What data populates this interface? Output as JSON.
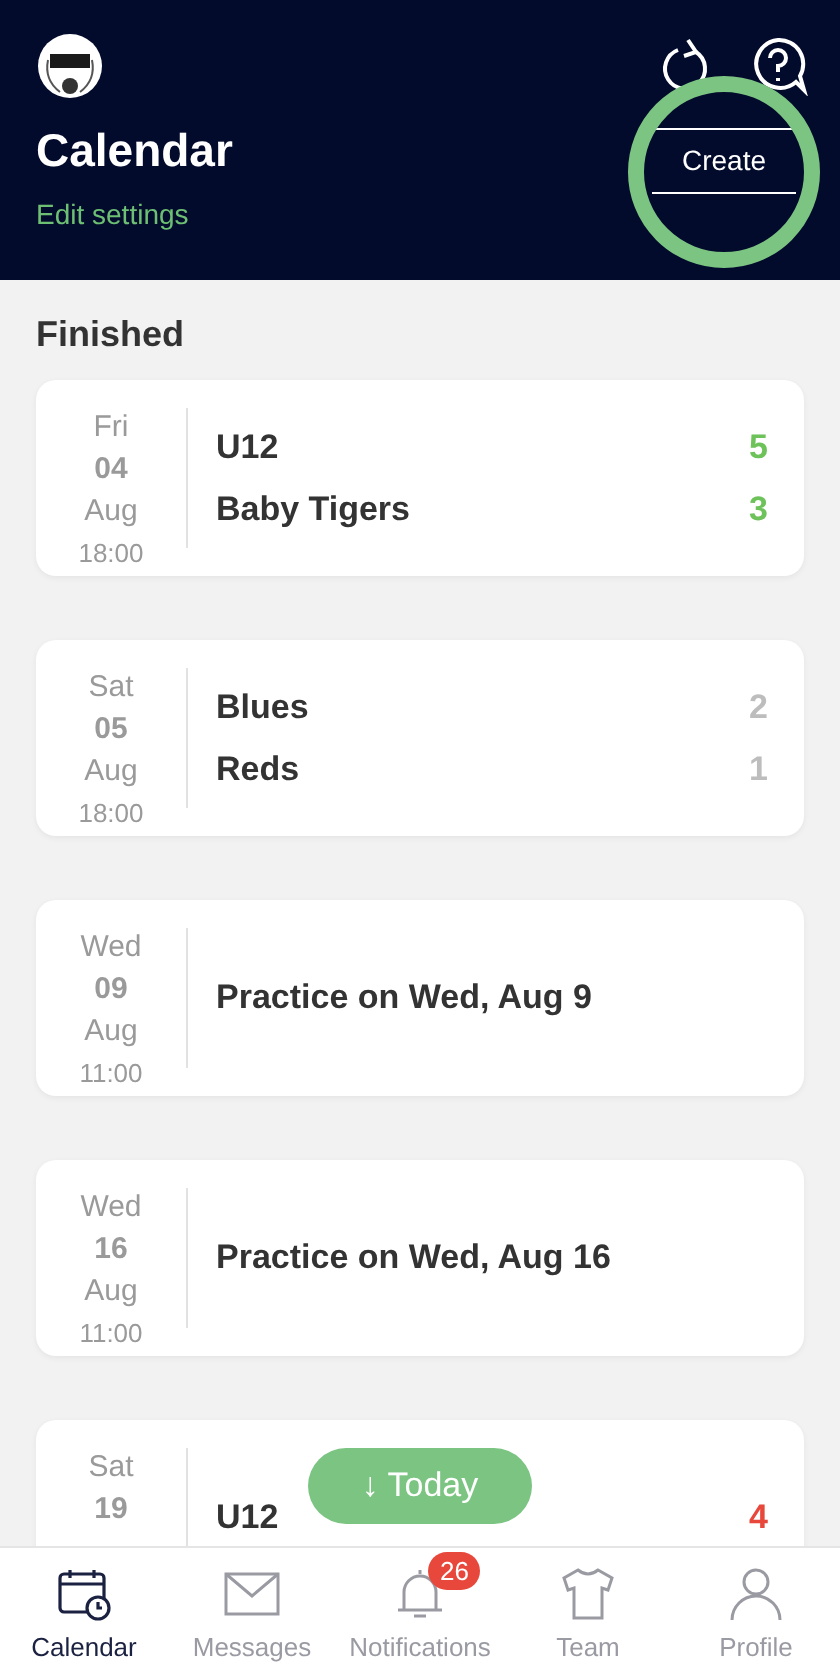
{
  "header": {
    "title": "Calendar",
    "subtitle": "Edit settings",
    "create_button": "Create"
  },
  "section": "Finished",
  "events": [
    {
      "kind": "match",
      "day": "Fri",
      "date": "04",
      "month": "Aug",
      "time": "18:00",
      "color": "#6dc25a",
      "teams": [
        {
          "name": "U12",
          "score": "5"
        },
        {
          "name": "Baby Tigers",
          "score": "3"
        }
      ]
    },
    {
      "kind": "match",
      "day": "Sat",
      "date": "05",
      "month": "Aug",
      "time": "18:00",
      "color": "#bdbdbd",
      "teams": [
        {
          "name": "Blues",
          "score": "2"
        },
        {
          "name": "Reds",
          "score": "1"
        }
      ]
    },
    {
      "kind": "practice",
      "day": "Wed",
      "date": "09",
      "month": "Aug",
      "time": "11:00",
      "title": "Practice on Wed, Aug 9"
    },
    {
      "kind": "practice",
      "day": "Wed",
      "date": "16",
      "month": "Aug",
      "time": "11:00",
      "title": "Practice on Wed, Aug 16"
    },
    {
      "kind": "match",
      "day": "Sat",
      "date": "19",
      "color": "#e8483c",
      "teams": [
        {
          "name": "U12",
          "score": "4"
        }
      ]
    }
  ],
  "today_button": "↓ Today",
  "tabs": [
    {
      "kind": "calendar",
      "label": "Calendar",
      "selected": true
    },
    {
      "kind": "messages",
      "label": "Messages",
      "selected": false
    },
    {
      "kind": "notifications",
      "label": "Notifications",
      "selected": false,
      "badge": "26"
    },
    {
      "kind": "team",
      "label": "Team",
      "selected": false
    },
    {
      "kind": "profile",
      "label": "Profile",
      "selected": false
    }
  ]
}
